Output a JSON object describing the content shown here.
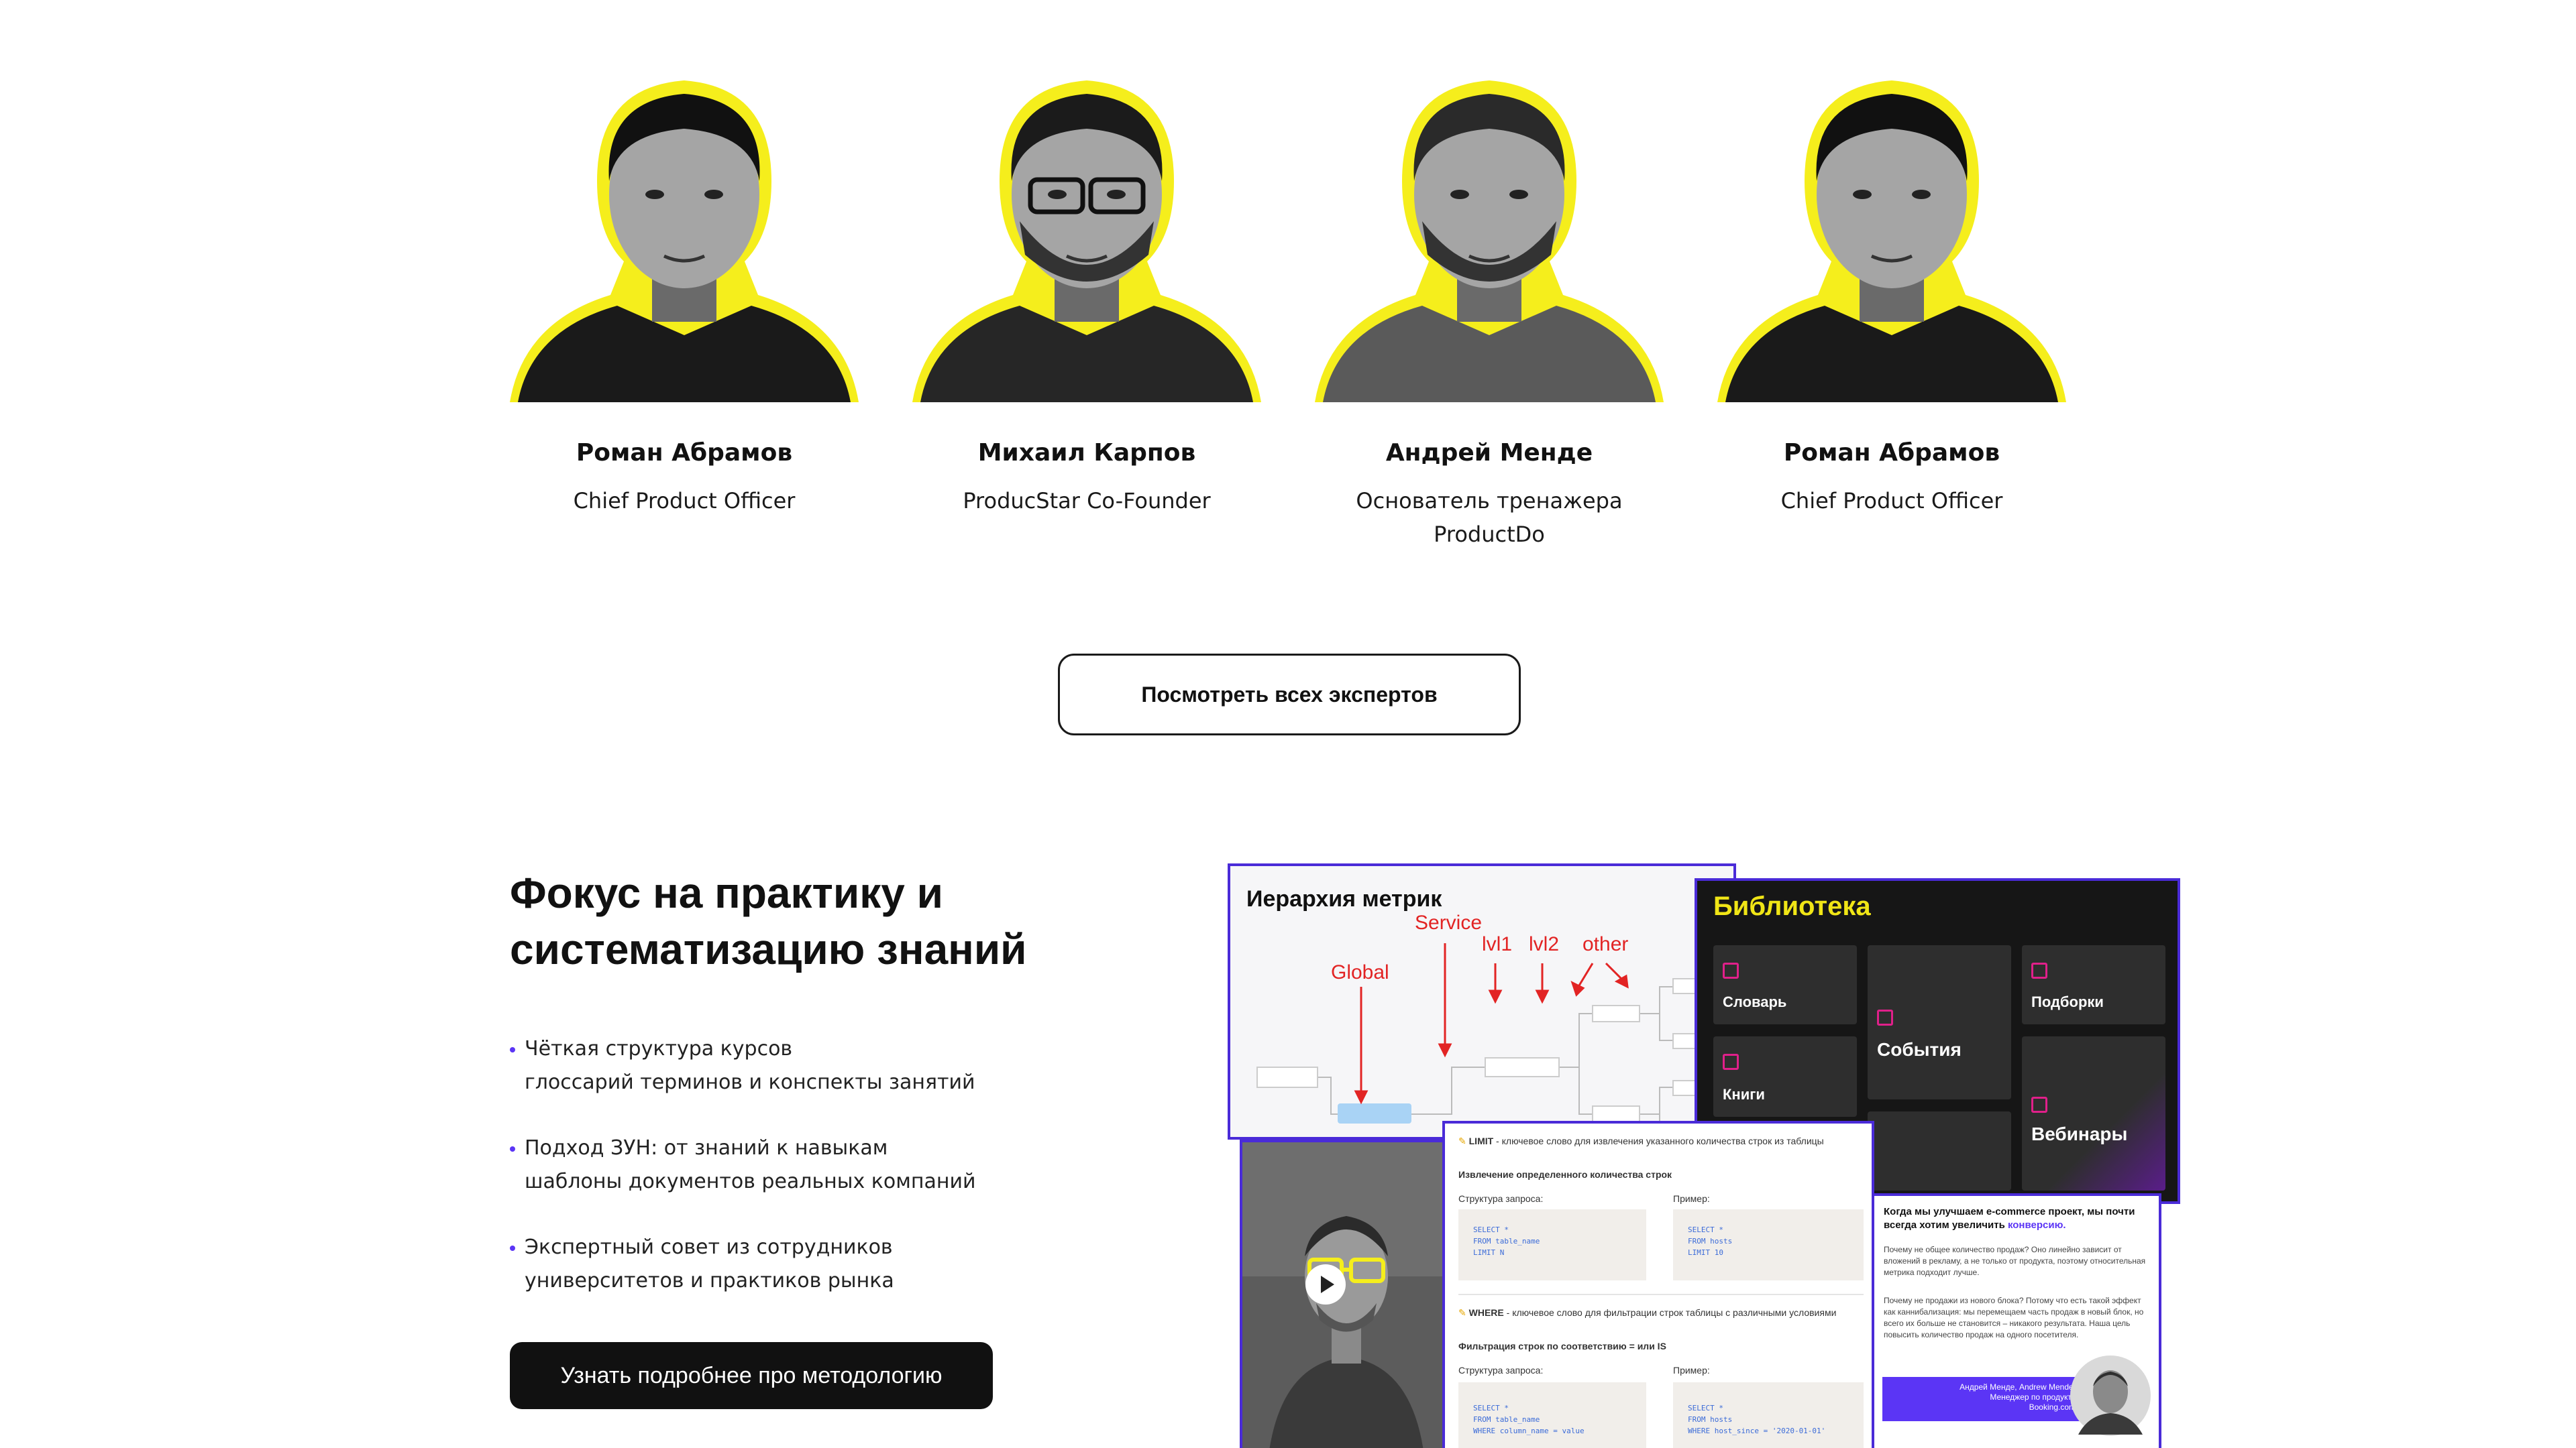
{
  "experts": [
    {
      "name": "Роман Абрамов",
      "role": "Chief Product Officer",
      "hair": "#111111",
      "shirt": "#1a1a1a",
      "glasses": false,
      "beard": false
    },
    {
      "name": "Михаил Карпов",
      "role": "ProducStar Co-Founder",
      "hair": "#1b1b1b",
      "shirt": "#262626",
      "glasses": true,
      "beard": true
    },
    {
      "name": "Андрей Менде",
      "role": "Основатель тренажера ProductDo",
      "hair": "#2a2a2a",
      "shirt": "#5a5a5a",
      "glasses": false,
      "beard": true
    },
    {
      "name": "Роман Абрамов",
      "role": "Chief Product Officer",
      "hair": "#111111",
      "shirt": "#1a1a1a",
      "glasses": false,
      "beard": false
    }
  ],
  "buttons": {
    "all_experts": "Посмотреть всех экспертов",
    "methodology": "Узнать подробнее про методологию"
  },
  "focus": {
    "title_line1": "Фокус на практику и",
    "title_line2": "систематизацию знаний",
    "bullets": [
      {
        "line1": "Чёткая структура курсов",
        "line2": "глоссарий терминов и конспекты занятий"
      },
      {
        "line1": "Подход ЗУН: от знаний к навыкам",
        "line2": "шаблоны документов реальных компаний"
      },
      {
        "line1": "Экспертный совет из сотрудников",
        "line2": "университетов и практиков рынка"
      }
    ]
  },
  "collage": {
    "metrics": {
      "title": "Иерархия метрик",
      "labels": [
        "Global",
        "Service",
        "lvl1",
        "lvl2",
        "other"
      ]
    },
    "library": {
      "title": "Библиотека",
      "tiles": [
        "Словарь",
        "События",
        "Подборки",
        "Книги",
        "Вебинары"
      ]
    },
    "sql": {
      "limit_head": "LIMIT",
      "limit_desc": " - ключевое слово для извлечения указанного количества строк из таблицы",
      "limit_sub": "Извлечение определенного количества строк",
      "struct_label": "Структура запроса:",
      "example_label": "Пример:",
      "code1": [
        "SELECT *",
        "FROM table_name",
        "LIMIT N"
      ],
      "code2": [
        "SELECT *",
        "FROM hosts",
        "LIMIT 10"
      ],
      "where_head": "WHERE",
      "where_desc": " - ключевое слово для фильтрации строк таблицы с различными условиями",
      "where_sub": "Фильтрация строк по соответствию = или IS",
      "code3": [
        "SELECT *",
        "FROM table_name",
        "WHERE column_name = value"
      ],
      "code4": [
        "SELECT *",
        "FROM hosts",
        "WHERE host_since = '2020-01-01'"
      ]
    },
    "note": {
      "head_before": "Когда мы улучшаем e-commerce проект, мы почти всегда хотим увеличить ",
      "head_accent": "конверсию.",
      "para1": "Почему не общее количество продаж? Оно линейно зависит от вложений в рекламу, а не только от продукта, поэтому относительная метрика подходит лучше.",
      "para2": "Почему не продажи из нового блока? Потому что есть такой эффект как каннибализация: мы перемещаем часть продаж в новый блок, но всего их больше не становится – никакого результата. Наша цель повысить количество продаж на одного посетителя.",
      "sign_line1": "Андрей Менде, Andrew Mende,",
      "sign_line2": "Менеджер по продукту",
      "sign_line3": "Booking.com"
    }
  },
  "colors": {
    "accent_yellow": "#f5ee1c",
    "accent_purple": "#5b35f5",
    "frame_blue": "#4a2bd8",
    "pink": "#e0208a"
  }
}
